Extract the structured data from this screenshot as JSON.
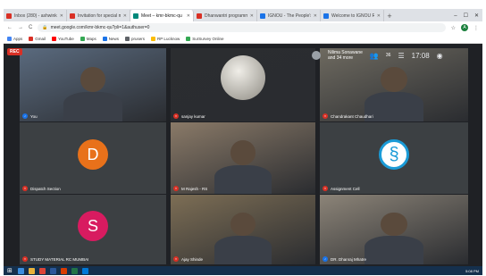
{
  "browser": {
    "tabs": [
      {
        "label": "Inbox (280) - ashwinkr",
        "fav": "#d93025",
        "active": false
      },
      {
        "label": "Invitation for special m",
        "fav": "#d93025",
        "active": false
      },
      {
        "label": "Meet – kmr-bkmc-qu",
        "fav": "#00897b",
        "active": true
      },
      {
        "label": "Dhanwantri programme",
        "fav": "#d93025",
        "active": false
      },
      {
        "label": "IGNOU - The People's U",
        "fav": "#1a73e8",
        "active": false
      },
      {
        "label": "Welcome to IGNOU Re",
        "fav": "#1a73e8",
        "active": false
      }
    ],
    "new_tab": "+",
    "window_controls": [
      "–",
      "☐",
      "✕"
    ],
    "nav": [
      "←",
      "→",
      "C"
    ],
    "url": "meet.google.com/kmr-bkmc-qu?pli=1&authuser=0",
    "bookmarks": [
      {
        "label": "Apps",
        "color": "#4285f4"
      },
      {
        "label": "Gmail",
        "color": "#d93025"
      },
      {
        "label": "YouTube",
        "color": "#ff0000"
      },
      {
        "label": "Maps",
        "color": "#34a853"
      },
      {
        "label": "News",
        "color": "#1a73e8"
      },
      {
        "label": "prusers",
        "color": "#5f6368"
      },
      {
        "label": "RP Lucknow",
        "color": "#fbbc04"
      },
      {
        "label": "SurSurvey Online",
        "color": "#34a853"
      }
    ],
    "profile_initial": "A"
  },
  "meet": {
    "rec_label": "REC",
    "presenter_label": "Nilima Sonawane",
    "presenter_sub": "and 34 more",
    "count": "36",
    "time": "17:08",
    "participants": [
      {
        "name": "You",
        "kind": "video",
        "bg": "#5a6a7e",
        "mic": "on"
      },
      {
        "name": "sanjay kumar",
        "kind": "video",
        "bg": "#2b2d30",
        "mic": "off"
      },
      {
        "name": "Chandrakant Chaudhari",
        "kind": "video",
        "bg": "#6e6a60",
        "mic": "off"
      },
      {
        "name": "Dispatch Section",
        "kind": "letter",
        "letter": "D",
        "color": "#e8711a",
        "mic": "off"
      },
      {
        "name": "M Rajesh - RS",
        "kind": "video",
        "bg": "#8a7a68",
        "mic": "off"
      },
      {
        "name": "Assignment Cell",
        "kind": "logo",
        "color": "#1a9bd7",
        "mic": "off"
      },
      {
        "name": "STUDY MATERIAL RC MUMBAI",
        "kind": "letter",
        "letter": "S",
        "color": "#d81b60",
        "mic": "off"
      },
      {
        "name": "Ajay Shinde",
        "kind": "video",
        "bg": "#7d6e55",
        "mic": "off"
      },
      {
        "name": "DR. Dhanraj Mhatre",
        "kind": "video",
        "bg": "#8c8478",
        "mic": "on"
      }
    ]
  },
  "taskbar": {
    "clock": "5:08 PM",
    "apps": [
      "#3c8dde",
      "#e8b23b",
      "#db4437",
      "#2b579a",
      "#d83b01",
      "#217346",
      "#0078d7"
    ]
  }
}
